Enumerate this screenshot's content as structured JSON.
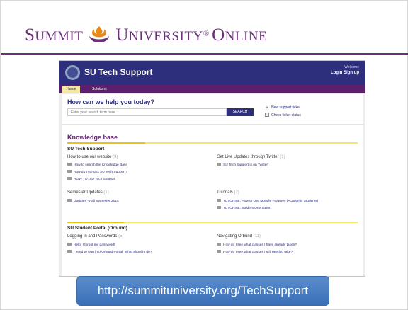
{
  "brand": {
    "word1_cap": "S",
    "word1_rest": "UMMIT",
    "word2_cap": "U",
    "word2_rest": "NIVERSITY",
    "reg": "®",
    "word3_cap": "O",
    "word3_rest": "NLINE",
    "colors": {
      "purple": "#6a3178",
      "orange": "#e88a1a"
    },
    "logo_icon": "summit-flame-logo-icon"
  },
  "site": {
    "title": "SU Tech Support",
    "welcome": "Welcome",
    "login": "Login",
    "signup": "Sign up",
    "tabs": [
      {
        "label": "Home"
      },
      {
        "label": "Solutions"
      }
    ],
    "help": {
      "title": "How can we help you today?",
      "search_placeholder": "Enter your search term here...",
      "search_button": "SEARCH",
      "new_ticket": "New support ticket",
      "check_status": "Check ticket status"
    },
    "kb": {
      "title": "Knowledge base",
      "sections": [
        {
          "title": "SU Tech Support",
          "categories": [
            {
              "title": "How to use our website",
              "count": "(3)",
              "articles": [
                "How to search the Knowledge Base",
                "How do I contact SU Tech Support?",
                "HOW TO: SU Tech Support"
              ]
            },
            {
              "title": "Get Live Updates through Twitter",
              "count": "(1)",
              "articles": [
                "SU Tech Support is on Twitter!"
              ]
            },
            {
              "title": "Semester Updates",
              "count": "(1)",
              "articles": [
                "Updates - Fall Semester 2015"
              ]
            },
            {
              "title": "Tutorials",
              "count": "(2)",
              "articles": [
                "TUTORIAL: How to Use Moodle Features (Academic Students)",
                "TUTORIAL: Student Orientation"
              ]
            }
          ]
        },
        {
          "title": "SU Student Portal (Orbund)",
          "categories": [
            {
              "title": "Logging in and Passwords",
              "count": "(5)",
              "articles": [
                "Help! I forgot my password!",
                "I need to sign into Orbund Portal. What should I do?"
              ]
            },
            {
              "title": "Navigating Orbund",
              "count": "(11)",
              "articles": [
                "How do I see what classes I have already taken?",
                "How do I see what classes I still need to take?"
              ]
            }
          ]
        }
      ]
    }
  },
  "banner": {
    "url": "http://summituniversity.org/TechSupport"
  }
}
